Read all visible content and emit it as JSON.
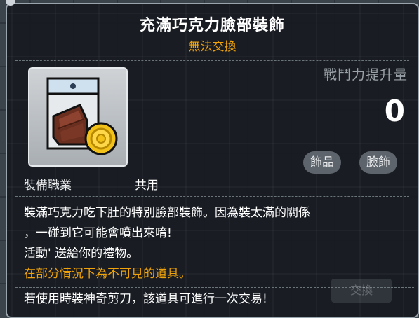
{
  "tooltip": {
    "title": "充滿巧克力臉部裝飾",
    "trade_note": "無法交換",
    "stat_label": "戰鬥力提升量",
    "stat_value": "0",
    "tags": [
      "飾品",
      "臉飾"
    ],
    "job_label": "裝備職業",
    "job_value": "共用",
    "description": [
      "裝滿巧克力吃下肚的特別臉部裝飾。因為裝太滿的關係",
      "，一碰到它可能會噴出來唷!",
      "活動' 送給你的禮物。"
    ],
    "notice": "在部分情況下為不可見的道具。",
    "scissor_note": "若使用時裝神奇剪刀，該道具可進行一次交易!",
    "ghost_button": "交換"
  },
  "item": {
    "icon": "chocolate-bar-with-gold-coin-icon"
  },
  "colors": {
    "accent_orange": "#f0a30a",
    "title_white": "#ffffff",
    "tooltip_border": "#9aa4ad"
  }
}
